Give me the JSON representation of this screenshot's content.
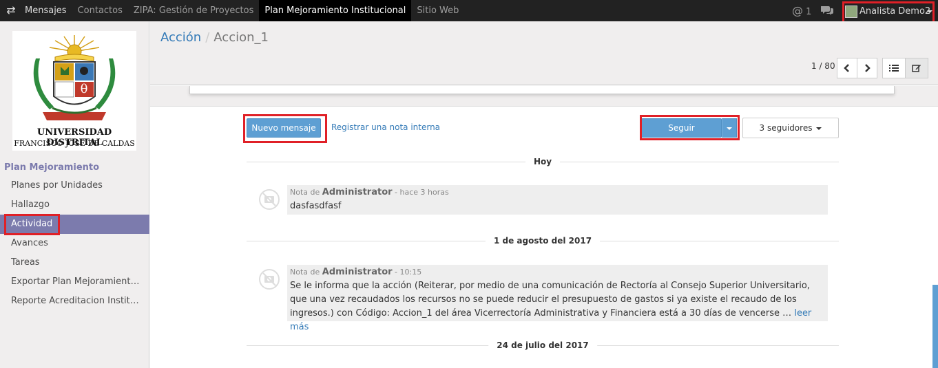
{
  "topbar": {
    "menu": [
      "Mensajes",
      "Contactos",
      "ZIPA: Gestión de Proyectos",
      "Plan Mejoramiento Institucional",
      "Sitio Web"
    ],
    "active_index": 3,
    "mentions_count": "1",
    "user_name": "Analista Demo2"
  },
  "logo": {
    "line1": "UNIVERSIDAD DISTRITAL",
    "line2": "FRANCISCO JOSÉ DE CALDAS"
  },
  "sidebar": {
    "section_title": "Plan Mejoramiento",
    "items": [
      {
        "label": "Planes por Unidades"
      },
      {
        "label": "Hallazgo"
      },
      {
        "label": "Actividad"
      },
      {
        "label": "Avances"
      },
      {
        "label": "Tareas"
      },
      {
        "label": "Exportar Plan Mejoramient…"
      },
      {
        "label": "Reporte Acreditacion Instit…"
      }
    ],
    "active_index": 2
  },
  "breadcrumb": {
    "parent": "Acción",
    "separator": "/",
    "current": "Accion_1"
  },
  "pager": {
    "value": "1 / 80"
  },
  "chatter": {
    "new_message": "Nuevo mensaje",
    "internal_note": "Registrar una nota interna",
    "follow": "Seguir",
    "followers": "3 seguidores"
  },
  "timeline": [
    {
      "date": "Hoy",
      "message": {
        "prefix": "Nota de",
        "author": "Administrator",
        "time": "- hace 3 horas",
        "body": "dasfasdfasf"
      }
    },
    {
      "date": "1 de agosto del 2017",
      "message": {
        "prefix": "Nota de",
        "author": "Administrator",
        "time": "- 10:15",
        "body": "Se le informa que la acción (Reiterar, por medio de una comunicación de Rectoría al Consejo Superior Universitario, que una vez recaudados los recursos no se puede reducir el presupuesto de gastos si ya existe el recaudo de los ingresos.) con Código: Accion_1 del área Vicerrectoría Administrativa y Financiera está a 30 días de vencerse …",
        "more": "leer más"
      }
    },
    {
      "date": "24 de julio del 2017"
    }
  ],
  "colors": {
    "accent": "#7c7bad",
    "primary_button": "#5e9fd3",
    "highlight": "#e02027",
    "topbar": "#222222"
  },
  "icons": {
    "apps_toggle": "swap-arrows-icon",
    "mentions": "at-icon",
    "chat": "chat-icon",
    "prev": "chevron-left-icon",
    "next": "chevron-right-icon",
    "list_view": "list-icon",
    "form_view": "edit-icon"
  }
}
